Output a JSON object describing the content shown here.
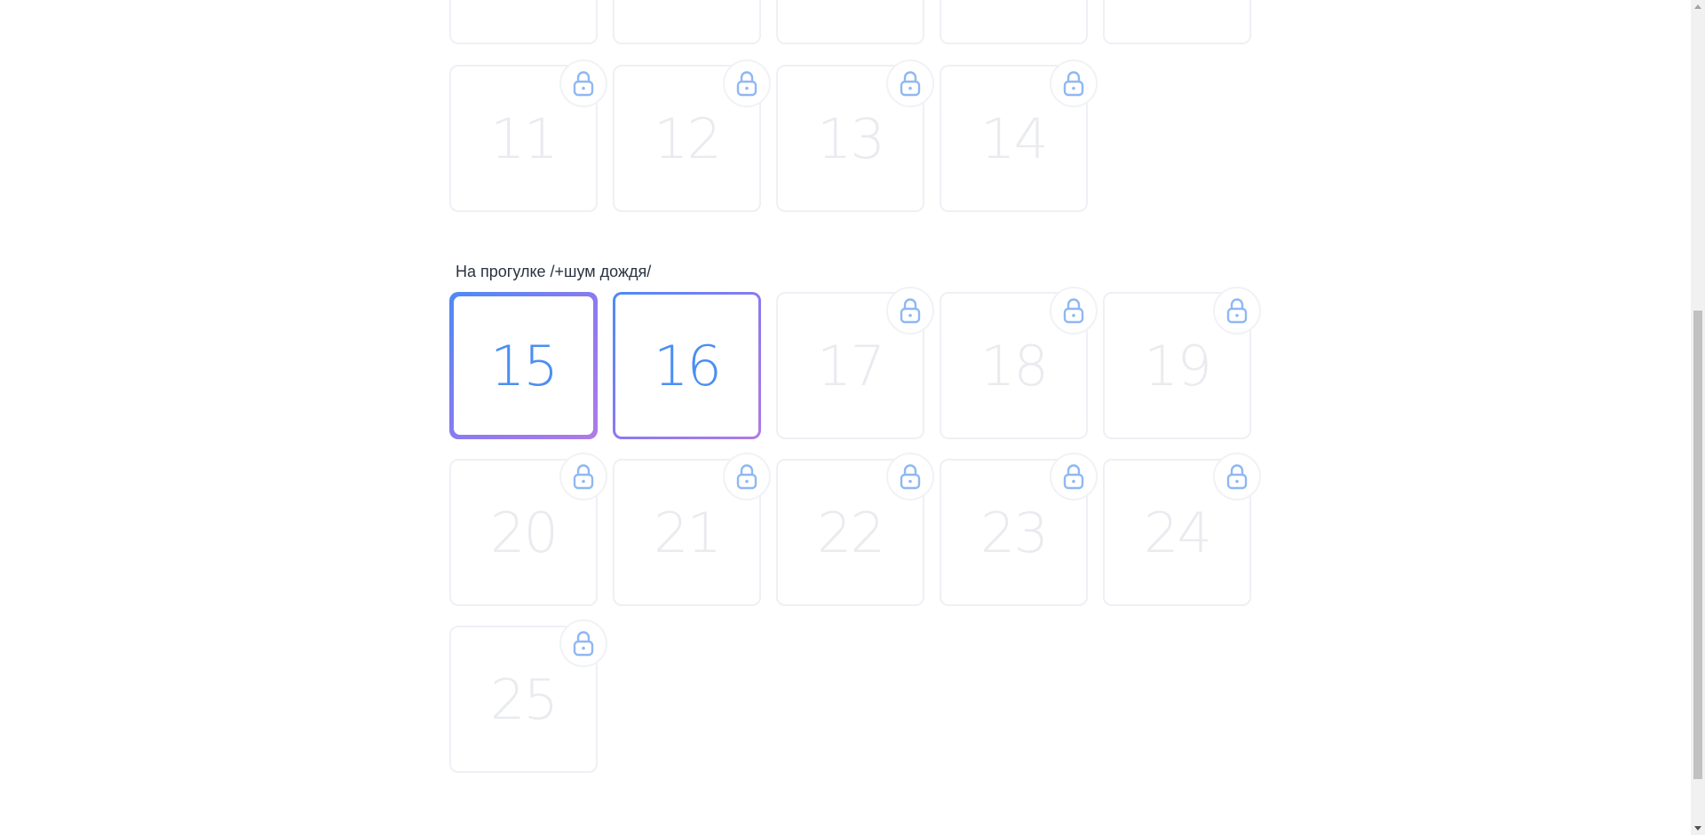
{
  "section": {
    "title": "На прогулке /+шум дождя/"
  },
  "tiles": {
    "t11": "11",
    "t12": "12",
    "t13": "13",
    "t14": "14",
    "t15": "15",
    "t16": "16",
    "t17": "17",
    "t18": "18",
    "t19": "19",
    "t20": "20",
    "t21": "21",
    "t22": "22",
    "t23": "23",
    "t24": "24",
    "t25": "25"
  },
  "icons": {
    "lock": "lock-icon"
  },
  "colors": {
    "accent_blue": "#4a8ff2",
    "accent_purple": "#b07ae8",
    "lock_icon": "#8fb8f2",
    "locked_number": "#eaebef"
  }
}
